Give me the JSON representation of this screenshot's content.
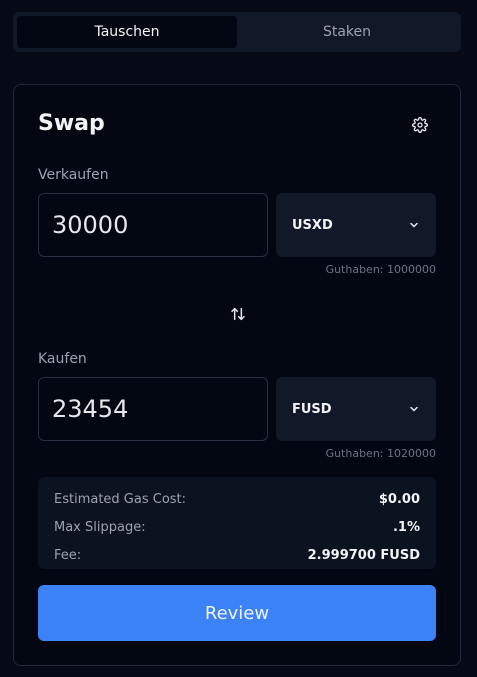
{
  "tabs": [
    {
      "label": "Tauschen",
      "active": true
    },
    {
      "label": "Staken",
      "active": false
    }
  ],
  "card": {
    "title": "Swap",
    "settings_icon": "gear-icon"
  },
  "sell": {
    "label": "Verkaufen",
    "amount": "30000",
    "token": "USXD",
    "balance": "Guthaben: 1000000"
  },
  "buy": {
    "label": "Kaufen",
    "amount": "23454",
    "token": "FUSD",
    "balance": "Guthaben: 1020000"
  },
  "swap_direction_icon": "swap-arrows-icon",
  "details": [
    {
      "label": "Estimated Gas Cost:",
      "value": "$0.00"
    },
    {
      "label": "Max Slippage:",
      "value": ".1%"
    },
    {
      "label": "Fee:",
      "value": "2.999700 FUSD"
    }
  ],
  "review_label": "Review",
  "colors": {
    "background": "#050a16",
    "accent": "#3b82f6",
    "panel": "#111827"
  }
}
